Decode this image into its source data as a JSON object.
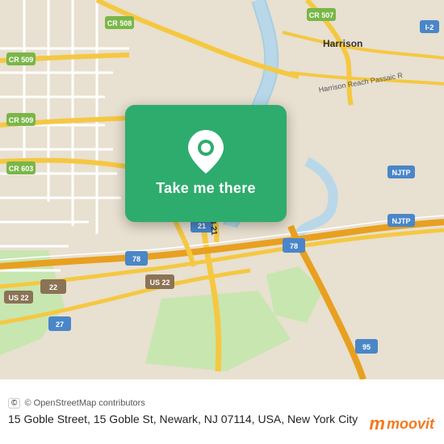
{
  "map": {
    "alt": "Map of Newark, NJ area",
    "center": "15 Goble St, Newark NJ"
  },
  "card": {
    "label": "Take me there"
  },
  "bottom_bar": {
    "osm_credit": "© OpenStreetMap contributors",
    "address": "15 Goble Street, 15 Goble St, Newark, NJ 07114, USA, New York City"
  },
  "moovit": {
    "label": "moovit"
  }
}
